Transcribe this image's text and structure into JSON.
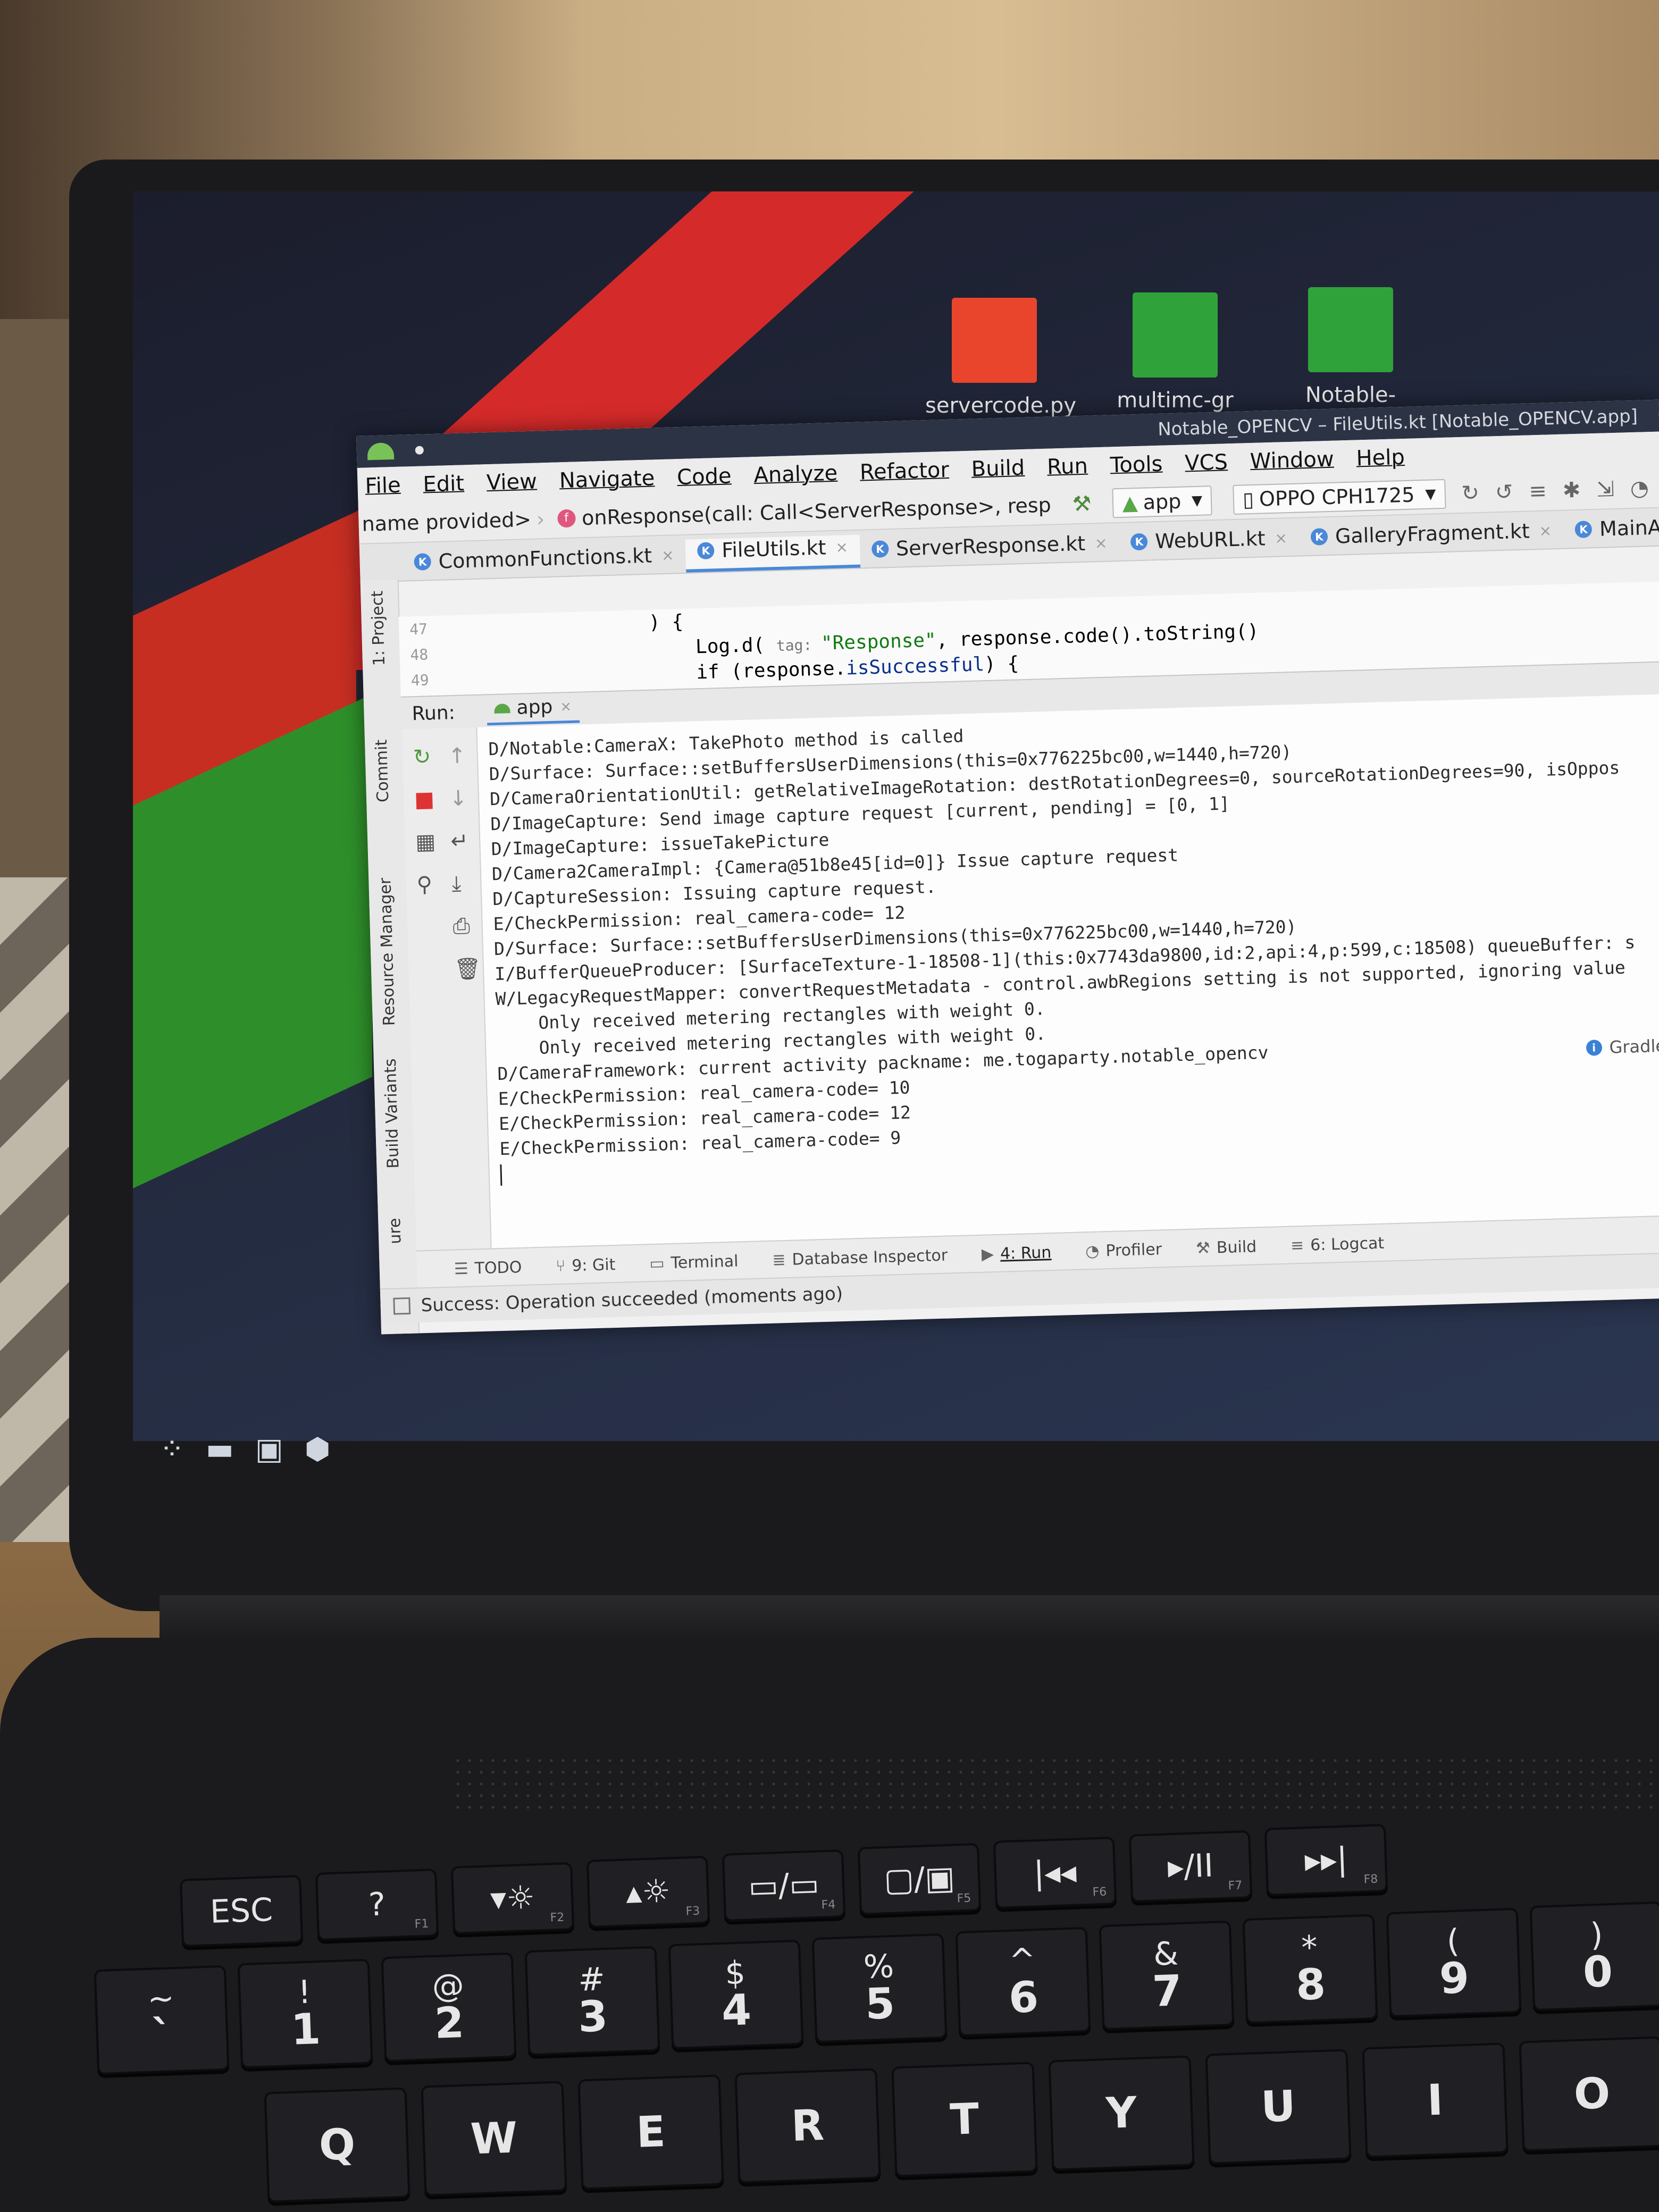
{
  "desktop": {
    "icons": [
      {
        "label": "servercode.py",
        "icon": "python-file-icon",
        "color": "#e8452c"
      },
      {
        "label": "multimc-gr",
        "icon": "folder-icon",
        "color": "#2fa33a"
      },
      {
        "label": "Notable-",
        "icon": "folder-icon",
        "color": "#2fa33a"
      }
    ],
    "accent_red": "#d52a2a",
    "accent_green": "#2e8f2a"
  },
  "window": {
    "title": "Notable_OPENCV – FileUtils.kt [Notable_OPENCV.app]"
  },
  "menubar": [
    "File",
    "Edit",
    "View",
    "Navigate",
    "Code",
    "Analyze",
    "Refactor",
    "Build",
    "Run",
    "Tools",
    "VCS",
    "Window",
    "Help"
  ],
  "navbar": {
    "breadcrumb": "name provided>",
    "function_badge": "f",
    "function_sig": "onResponse(call: Call<ServerResponse>, resp",
    "run_config": "app",
    "device": "OPPO CPH1725"
  },
  "editor_tabs": [
    {
      "name": "CommonFunctions.kt",
      "active": false
    },
    {
      "name": "FileUtils.kt",
      "active": true
    },
    {
      "name": "ServerResponse.kt",
      "active": false
    },
    {
      "name": "WebURL.kt",
      "active": false
    },
    {
      "name": "GalleryFragment.kt",
      "active": false
    },
    {
      "name": "MainActiv",
      "active": false
    }
  ],
  "code": [
    {
      "ln": "47",
      "text": "            ) {"
    },
    {
      "ln": "48",
      "pre": "                Log.d( ",
      "hint": "tag: ",
      "str": "\"Response\"",
      "post": ", response.code().toString()"
    },
    {
      "ln": "49",
      "pre": "                if (response.",
      "call": "isSuccessful",
      "post": ") {"
    }
  ],
  "left_strip": {
    "project": "1: Project",
    "commit": "Commit",
    "resource_manager": "Resource Manager",
    "build_variants": "Build Variants",
    "structure": "ure"
  },
  "run_panel": {
    "label": "Run:",
    "tab": "app",
    "lines": [
      "D/Notable:CameraX: TakePhoto method is called",
      "D/Surface: Surface::setBuffersUserDimensions(this=0x776225bc00,w=1440,h=720)",
      "D/CameraOrientationUtil: getRelativeImageRotation: destRotationDegrees=0, sourceRotationDegrees=90, isOppos",
      "D/ImageCapture: Send image capture request [current, pending] = [0, 1]",
      "D/ImageCapture: issueTakePicture",
      "D/Camera2CameraImpl: {Camera@51b8e45[id=0]} Issue capture request",
      "D/CaptureSession: Issuing capture request.",
      "E/CheckPermission: real_camera-code= 12",
      "D/Surface: Surface::setBuffersUserDimensions(this=0x776225bc00,w=1440,h=720)",
      "I/BufferQueueProducer: [SurfaceTexture-1-18508-1](this:0x7743da9800,id:2,api:4,p:599,c:18508) queueBuffer: s",
      "W/LegacyRequestMapper: convertRequestMetadata - control.awbRegions setting is not supported, ignoring value",
      "    Only received metering rectangles with weight 0.",
      "    Only received metering rectangles with weight 0.",
      "D/CameraFramework: current activity packname: me.togaparty.notable_opencv",
      "E/CheckPermission: real_camera-code= 10",
      "E/CheckPermission: real_camera-code= 12",
      "E/CheckPermission: real_camera-code= 9"
    ],
    "gradle_notice": "Gradle"
  },
  "bottom_tools": [
    {
      "label": "TODO",
      "icon": "list-icon"
    },
    {
      "label": "9: Git",
      "icon": "git-branch-icon"
    },
    {
      "label": "Terminal",
      "icon": "terminal-icon"
    },
    {
      "label": "Database Inspector",
      "icon": "database-icon"
    },
    {
      "label": "4: Run",
      "icon": "run-icon",
      "active": true
    },
    {
      "label": "Profiler",
      "icon": "profiler-icon"
    },
    {
      "label": "Build",
      "icon": "hammer-icon"
    },
    {
      "label": "6: Logcat",
      "icon": "logcat-icon"
    }
  ],
  "status": "Success: Operation succeeded (moments ago)",
  "keyboard": {
    "fn_row": [
      {
        "top": "ESC"
      },
      {
        "top": "?",
        "fn": "F1"
      },
      {
        "top": "▾☼",
        "fn": "F2"
      },
      {
        "top": "▴☼",
        "fn": "F3"
      },
      {
        "top": "▭/▭",
        "fn": "F4"
      },
      {
        "top": "▢/▣",
        "fn": "F5"
      },
      {
        "top": "|◂◂",
        "fn": "F6"
      },
      {
        "top": "▸/II",
        "fn": "F7"
      },
      {
        "top": "▸▸|",
        "fn": "F8"
      }
    ],
    "num_row": [
      {
        "top": "~",
        "bot": "`"
      },
      {
        "top": "!",
        "bot": "1"
      },
      {
        "top": "@",
        "bot": "2"
      },
      {
        "top": "#",
        "bot": "3"
      },
      {
        "top": "$",
        "bot": "4"
      },
      {
        "top": "%",
        "bot": "5"
      },
      {
        "top": "^",
        "bot": "6"
      },
      {
        "top": "&",
        "bot": "7"
      },
      {
        "top": "*",
        "bot": "8"
      },
      {
        "top": "(",
        "bot": "9"
      },
      {
        "top": ")",
        "bot": "0"
      }
    ],
    "letter_row": [
      "Q",
      "W",
      "E",
      "R",
      "T",
      "Y",
      "U",
      "I",
      "O"
    ]
  }
}
